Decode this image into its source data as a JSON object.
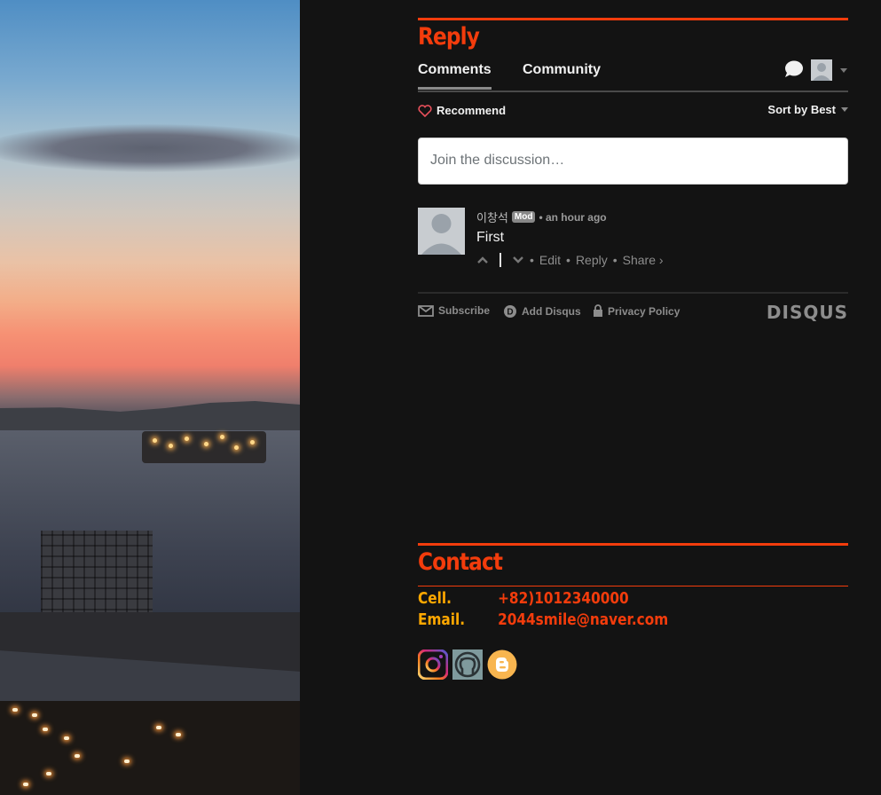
{
  "reply": {
    "title": "Reply",
    "tabs": [
      {
        "label": "Comments",
        "active": true
      },
      {
        "label": "Community",
        "active": false
      }
    ],
    "recommend_label": "Recommend",
    "sort_label": "Sort by Best",
    "input_placeholder": "Join the discussion…",
    "comment": {
      "author": "이창석",
      "badge": "Mod",
      "time": "• an hour ago",
      "body": "First",
      "actions": [
        "Edit",
        "Reply",
        "Share ›"
      ]
    },
    "footer": {
      "subscribe": "Subscribe",
      "add_disqus": "Add Disqus",
      "privacy": "Privacy Policy",
      "logo": "DISQUS"
    }
  },
  "contact": {
    "title": "Contact",
    "cell_label": "Cell.",
    "cell_value": "+82)1012340000",
    "email_label": "Email.",
    "email_value": "2044smile@naver.com",
    "socials": [
      "instagram-icon",
      "github-icon",
      "blogger-icon"
    ]
  },
  "colors": {
    "accent": "#f33c0c",
    "label_yellow": "#ffa800",
    "background": "#131313"
  }
}
